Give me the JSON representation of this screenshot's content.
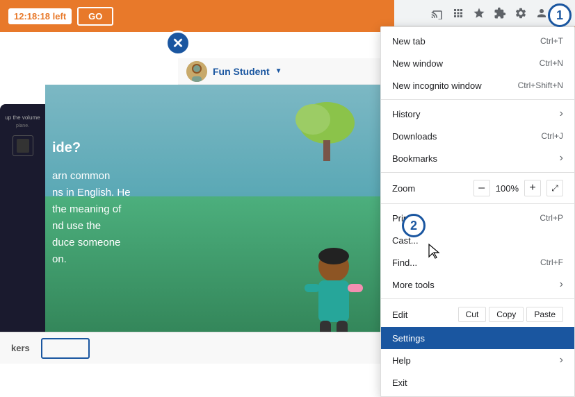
{
  "timer": "12:18:18 left",
  "go_button": "GO",
  "user": {
    "name": "Fun Student",
    "avatar_alt": "student avatar"
  },
  "toolbar": {
    "icons": [
      "cast-icon",
      "grid-icon",
      "star-icon",
      "puzzle-icon",
      "gear-icon",
      "avatar-icon",
      "menu-icon"
    ]
  },
  "menu": {
    "items": [
      {
        "label": "New tab",
        "shortcut": "Ctrl+T",
        "has_arrow": false
      },
      {
        "label": "New window",
        "shortcut": "Ctrl+N",
        "has_arrow": false
      },
      {
        "label": "New incognito window",
        "shortcut": "Ctrl+Shift+N",
        "has_arrow": false
      }
    ],
    "zoom": {
      "label": "Zoom",
      "minus": "–",
      "value": "100%",
      "plus": "+",
      "fullscreen": "⤢"
    },
    "middle_items": [
      {
        "label": "History",
        "shortcut": "",
        "has_arrow": true
      },
      {
        "label": "Downloads",
        "shortcut": "Ctrl+J",
        "has_arrow": false
      },
      {
        "label": "Bookmarks",
        "shortcut": "",
        "has_arrow": true
      }
    ],
    "lower_items": [
      {
        "label": "Print...",
        "shortcut": "Ctrl+P",
        "has_arrow": false
      },
      {
        "label": "Cast...",
        "shortcut": "",
        "has_arrow": false
      },
      {
        "label": "Find...",
        "shortcut": "Ctrl+F",
        "has_arrow": false
      },
      {
        "label": "More tools",
        "shortcut": "",
        "has_arrow": true
      }
    ],
    "edit": {
      "label": "Edit",
      "cut": "Cut",
      "copy": "Copy",
      "paste": "Paste"
    },
    "settings": {
      "label": "Settings",
      "highlighted": true
    },
    "help": {
      "label": "Help",
      "has_arrow": true
    },
    "exit": {
      "label": "Exit"
    }
  },
  "content": {
    "title": "ide?",
    "text_lines": [
      "arn common",
      "ns in English. He",
      "the meaning of",
      "nd use the",
      "duce someone",
      "on."
    ]
  },
  "bottom": {
    "label": "kers"
  },
  "annotations": {
    "circle1": "1",
    "circle2": "2"
  }
}
